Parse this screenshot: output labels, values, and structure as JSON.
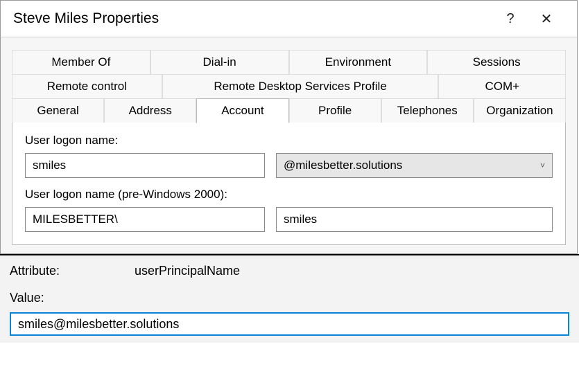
{
  "titlebar": {
    "title": "Steve Miles Properties",
    "help": "?",
    "close": "✕"
  },
  "tabs": {
    "row1": [
      "Member Of",
      "Dial-in",
      "Environment",
      "Sessions"
    ],
    "row2": [
      "Remote control",
      "Remote Desktop Services Profile",
      "COM+"
    ],
    "row3": [
      "General",
      "Address",
      "Account",
      "Profile",
      "Telephones",
      "Organization"
    ],
    "active": "Account"
  },
  "account": {
    "logon_label": "User logon name:",
    "logon_value": "smiles",
    "domain_selected": "@milesbetter.solutions",
    "pre_label": "User logon name (pre-Windows 2000):",
    "pre_domain": "MILESBETTER\\",
    "pre_user": "smiles"
  },
  "attribute": {
    "attr_label": "Attribute:",
    "attr_name": "userPrincipalName",
    "value_label": "Value:",
    "value": "smiles@milesbetter.solutions"
  }
}
